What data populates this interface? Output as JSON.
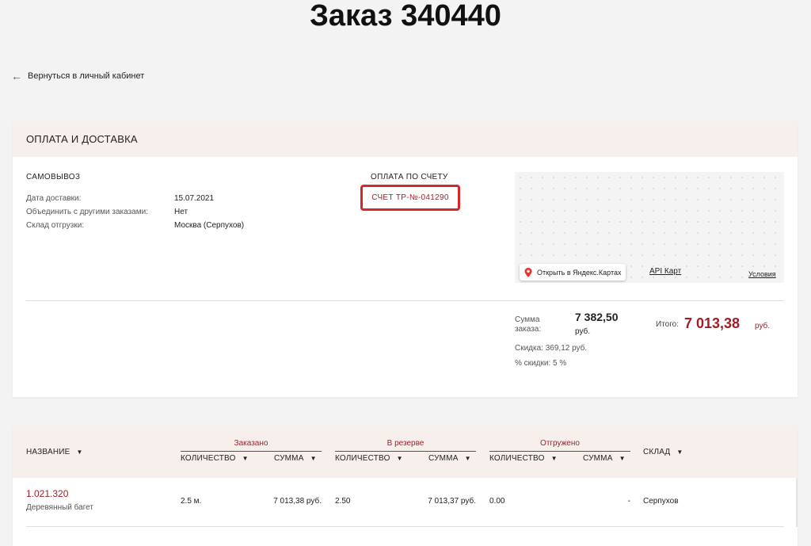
{
  "page_title": "Заказ 340440",
  "back_link": "Вернуться в личный кабинет",
  "payment_card": {
    "header": "ОПЛАТА И ДОСТАВКА",
    "delivery": {
      "title": "САМОВЫВОЗ",
      "rows": [
        {
          "label": "Дата доставки:",
          "value": "15.07.2021"
        },
        {
          "label": "Объединить с другими заказами:",
          "value": "Нет"
        },
        {
          "label": "Склад отгрузки:",
          "value": "Москва (Серпухов)"
        }
      ]
    },
    "payment": {
      "title": "ОПЛАТА ПО СЧЕТУ",
      "invoice_link": "СЧЕТ ТР-№-041290",
      "highlight_color": "#d9262a"
    },
    "map": {
      "open_button": "Открыть в Яндекс.Картах",
      "api_link": "API Карт",
      "terms_link": "Условия"
    },
    "totals": {
      "sum_label_1": "Сумма",
      "sum_label_2": "заказа:",
      "sum_value": "7 382,50",
      "sum_currency": "руб.",
      "total_label": "Итого:",
      "total_value": "7 013,38",
      "total_currency": "руб.",
      "discount": "Скидка: 369,12 руб.",
      "discount_percent": "% скидки: 5 %"
    }
  },
  "table": {
    "col_name": "НАЗВАНИЕ",
    "col_warehouse": "СКЛАД",
    "groups": [
      {
        "title": "Заказано",
        "qty": "КОЛИЧЕСТВО",
        "sum": "СУММА"
      },
      {
        "title": "В резерве",
        "qty": "КОЛИЧЕСТВО",
        "sum": "СУММА"
      },
      {
        "title": "Отгружено",
        "qty": "КОЛИЧЕСТВО",
        "sum": "СУММА"
      }
    ],
    "rows": [
      {
        "sku": "1.021.320",
        "name": "Деревянный багет",
        "ordered_qty": "2.5 м.",
        "ordered_sum": "7 013,38 руб.",
        "reserved_qty": "2.50",
        "reserved_sum": "7 013,37 руб.",
        "shipped_qty": "0.00",
        "shipped_sum": "-",
        "warehouse": "Серпухов"
      }
    ],
    "accent_color": "#9c1f26"
  }
}
